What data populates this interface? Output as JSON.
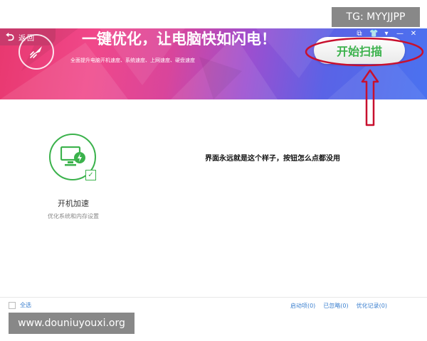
{
  "watermarks": {
    "top_right": "TG: MYYJJPP",
    "bottom_left": "www.douniuyouxi.org"
  },
  "header": {
    "back_label": "返回",
    "headline": "一键优化，让电脑快如闪电！",
    "subline": "全面提升电脑开机速度、系统速度、上网速度、硬盘速度",
    "scan_button": "开始扫描",
    "window_controls": [
      "⧉",
      "👕",
      "▾",
      "—",
      "✕"
    ]
  },
  "main": {
    "boost_title": "开机加速",
    "boost_subtitle": "优化系统和内存设置",
    "checkbox_mark": "✓",
    "note": "界面永远就是这个样子，按钮怎么点都没用"
  },
  "footer": {
    "select_all": "全选",
    "links": [
      "启动项(0)",
      "已忽略(0)",
      "优化记录(0)"
    ]
  },
  "colors": {
    "accent_green": "#3bb24c",
    "link_blue": "#3a7fcf",
    "annotation_red": "#c8102e"
  }
}
